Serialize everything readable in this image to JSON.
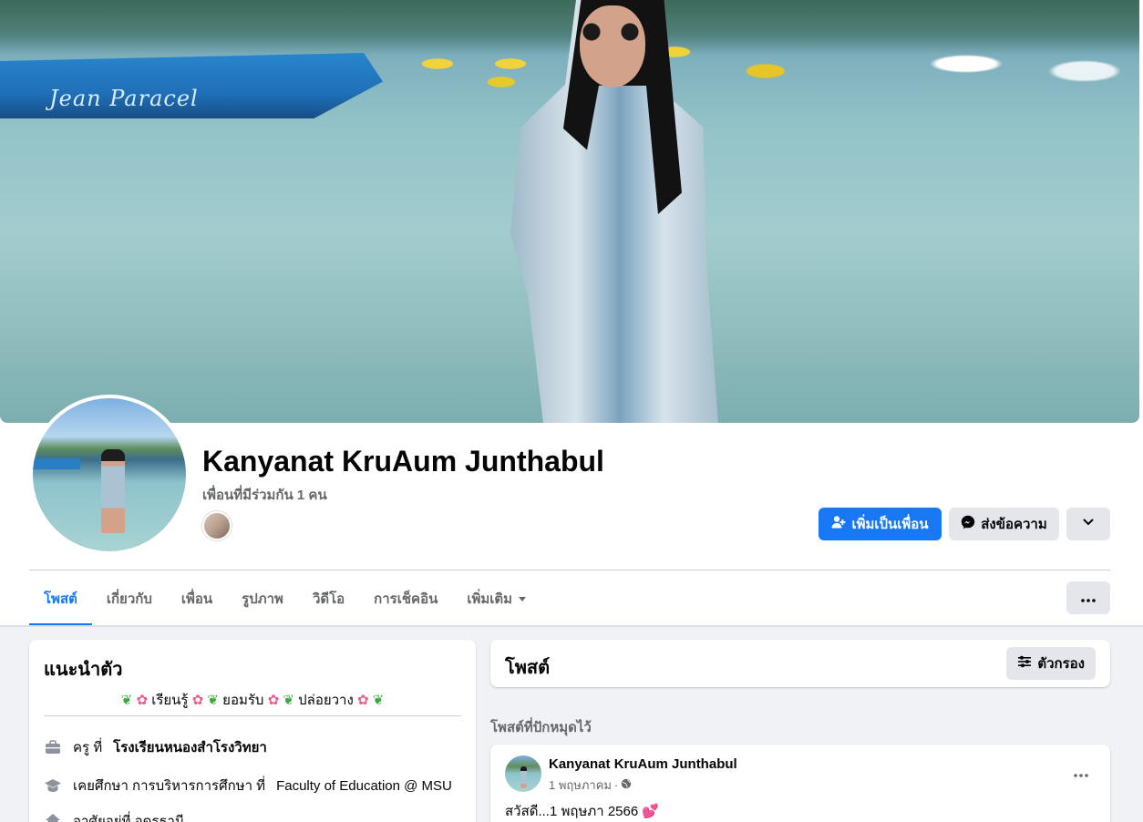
{
  "profile": {
    "name": "Kanyanat KruAum Junthabul",
    "mutual_friends": "เพื่อนที่มีร่วมกัน 1 คน",
    "cover_boat_text": "Jean Paracel"
  },
  "actions": {
    "add_friend": "เพิ่มเป็นเพื่อน",
    "message": "ส่งข้อความ"
  },
  "tabs": [
    {
      "label": "โพสต์",
      "active": true
    },
    {
      "label": "เกี่ยวกับ"
    },
    {
      "label": "เพื่อน"
    },
    {
      "label": "รูปภาพ"
    },
    {
      "label": "วิดีโอ"
    },
    {
      "label": "การเช็คอิน"
    },
    {
      "label": "เพิ่มเติม"
    }
  ],
  "intro": {
    "title": "แนะนำตัว",
    "bio_parts": [
      "เรียนรู้",
      "ยอมรับ",
      "ปล่อยวาง"
    ],
    "work_prefix": "ครู ที่",
    "work_place": "โรงเรียนหนองสำโรงวิทยา",
    "edu_prefix": "เคยศึกษา การบริหารการศึกษา ที่",
    "edu_place": "Faculty of Education @ MSU",
    "home_text": "อาศัยอยู่ที่ อุดรธานี"
  },
  "posts": {
    "title": "โพสต์",
    "filter_label": "ตัวกรอง",
    "pinned_label": "โพสต์ที่ปักหมุดไว้",
    "pinned_post": {
      "author": "Kanyanat KruAum Junthabul",
      "date": "1 พฤษภาคม",
      "text": "สวัสดี...1 พฤษภา 2566"
    }
  },
  "colors": {
    "primary": "#1877f2",
    "secondary_button": "#e4e6eb",
    "page_background": "#f0f2f5"
  },
  "icons": [
    "add-friend-icon",
    "messenger-icon",
    "chevron-down-icon",
    "more-dots-icon",
    "filter-icon",
    "briefcase-icon",
    "graduation-cap-icon",
    "home-icon",
    "globe-icon",
    "leaf-icon",
    "flower-icon",
    "heart-icon"
  ]
}
